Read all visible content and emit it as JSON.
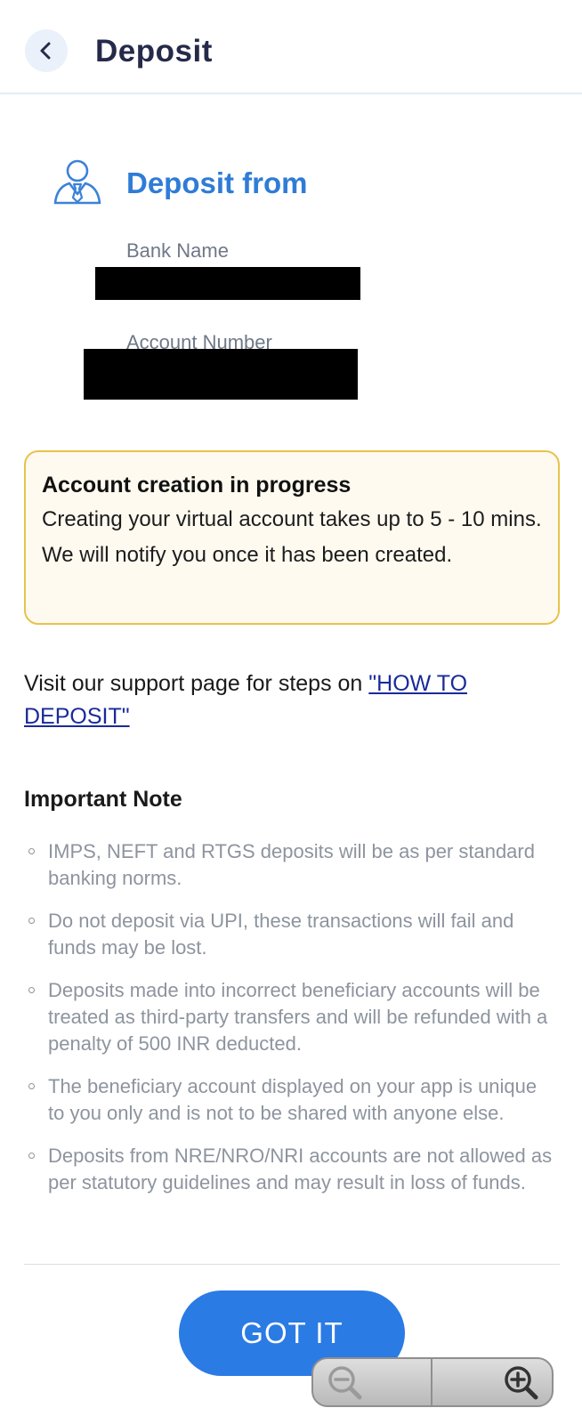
{
  "header": {
    "back_icon": "chevron-left-icon",
    "title": "Deposit"
  },
  "deposit_from": {
    "icon": "user-badge-icon",
    "heading": "Deposit from",
    "bank_name_label": "Bank Name",
    "account_number_label": "Account Number"
  },
  "notice": {
    "title": "Account creation in progress",
    "body": "Creating your virtual account takes up to 5 - 10 mins. We will notify you once it has been created."
  },
  "support": {
    "text": "Visit our support page for steps on ",
    "link_text": "\"HOW TO DEPOSIT\""
  },
  "important_note": {
    "heading": "Important Note",
    "items": [
      "IMPS, NEFT and RTGS deposits will be as per standard banking norms.",
      "Do not deposit via UPI, these transactions will fail and funds may be lost.",
      "Deposits made into incorrect beneficiary accounts will be treated as third-party transfers and will be refunded with a penalty of 500 INR deducted.",
      "The beneficiary account displayed on your app is unique to you only and is not to be shared with anyone else.",
      "Deposits from NRE/NRO/NRI accounts are not allowed as per statutory guidelines and may result in loss of funds."
    ]
  },
  "actions": {
    "got_it_label": "GOT IT"
  },
  "zoom_control": {
    "zoom_out_icon": "zoom-out-icon",
    "zoom_in_icon": "zoom-in-icon"
  },
  "colors": {
    "accent": "#2a7be4",
    "heading_blue": "#2f7cd6",
    "notice_border": "#e8c24c",
    "notice_bg": "#fffaf0",
    "note_text": "#8d949e"
  }
}
